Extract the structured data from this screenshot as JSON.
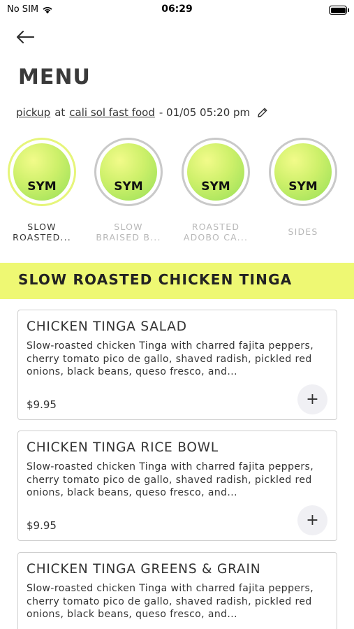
{
  "status_bar": {
    "carrier": "No SIM",
    "time": "06:29"
  },
  "header": {
    "title": "MENU"
  },
  "order": {
    "mode": "pickup",
    "at": "at",
    "location": "cali sol fast food",
    "schedule": "- 01/05 05:20 pm"
  },
  "categories": [
    {
      "logo": "SYM",
      "label_line1": "SLOW",
      "label_line2": "ROASTED...",
      "active": true
    },
    {
      "logo": "SYM",
      "label_line1": "SLOW",
      "label_line2": "BRAISED B...",
      "active": false
    },
    {
      "logo": "SYM",
      "label_line1": "ROASTED",
      "label_line2": "ADOBO CA...",
      "active": false
    },
    {
      "logo": "SYM",
      "label_line1": "SIDES",
      "label_line2": "",
      "active": false
    }
  ],
  "section": {
    "title": "SLOW ROASTED CHICKEN TINGA"
  },
  "items": [
    {
      "name": "CHICKEN TINGA SALAD",
      "description": "Slow-roasted chicken Tinga with charred fajita peppers, cherry tomato pico de gallo, shaved radish, pickled red onions, black beans, queso fresco, and...",
      "price": "$9.95",
      "add_label": "+"
    },
    {
      "name": "CHICKEN TINGA RICE BOWL",
      "description": "Slow-roasted chicken Tinga with charred fajita peppers, cherry tomato pico de gallo, shaved radish, pickled red onions, black beans, queso fresco, and...",
      "price": "$9.95",
      "add_label": "+"
    },
    {
      "name": "CHICKEN TINGA GREENS & GRAIN",
      "description": "Slow-roasted chicken Tinga with charred fajita peppers, cherry tomato pico de gallo, shaved radish, pickled red onions, black beans, queso fresco, and...",
      "price": "",
      "add_label": ""
    }
  ],
  "colors": {
    "accent": "#eef873",
    "active_ring": "#e6f57a",
    "logo_green": "#b9ea62"
  }
}
